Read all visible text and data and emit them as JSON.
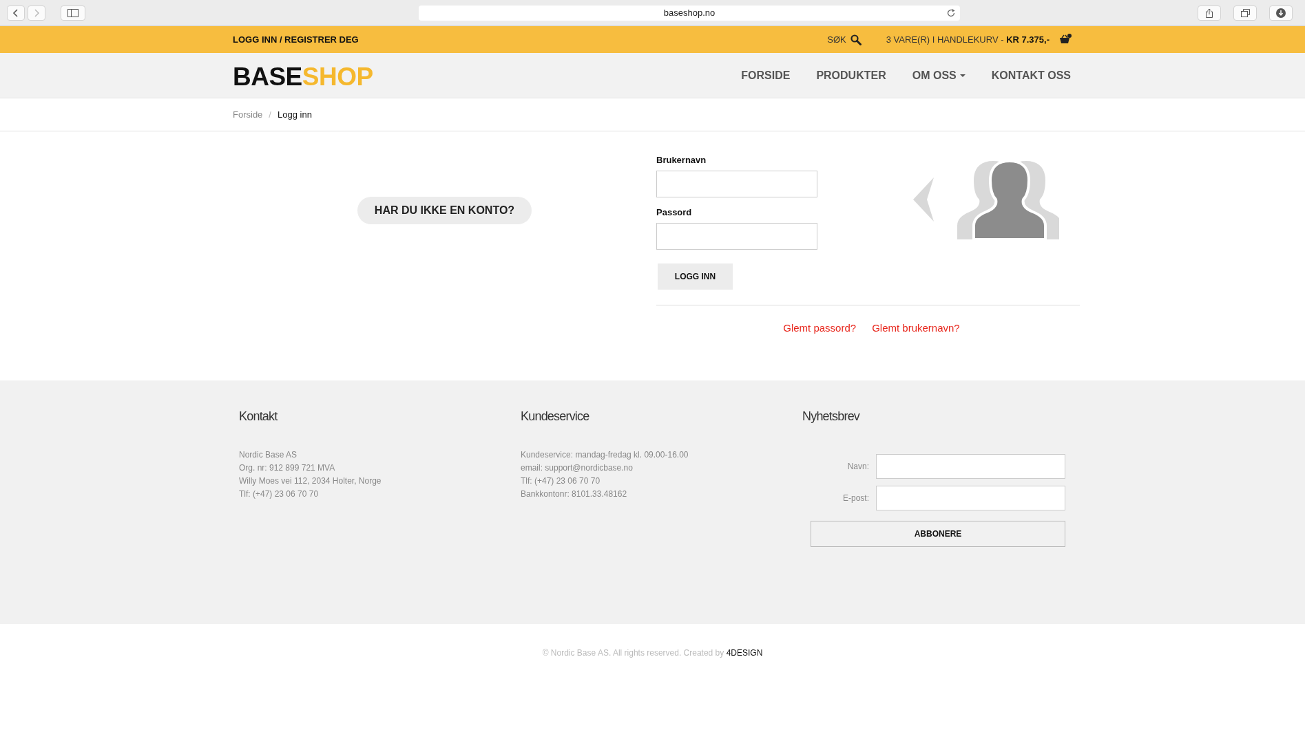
{
  "browser": {
    "url": "baseshop.no"
  },
  "top_bar": {
    "login_link": "LOGG INN / REGISTRER DEG",
    "search_label": "SØK",
    "cart": "3 VARE(R) I HANDLEKURV - **KR 7.375,-**"
  },
  "logo": {
    "first": "BASE",
    "second": "SHOP"
  },
  "nav": [
    {
      "label": "FORSIDE",
      "dropdown": false
    },
    {
      "label": "PRODUKTER",
      "dropdown": false
    },
    {
      "label": "OM OSS",
      "dropdown": true
    },
    {
      "label": "KONTAKT OSS",
      "dropdown": false
    }
  ],
  "breadcrumb": {
    "separator": "/",
    "items": [
      {
        "label": "Forside",
        "current": false
      },
      {
        "label": "Logg inn",
        "current": true
      }
    ]
  },
  "register_button": "HAR DU IKKE EN KONTO?",
  "login": {
    "fields": [
      {
        "label": "Brukernavn"
      },
      {
        "label": "Passord"
      }
    ],
    "button": "LOGG INN",
    "links": [
      "Glemt passord?",
      "Glemt brukernavn?"
    ]
  },
  "footer": {
    "columns": [
      {
        "title": "Kontakt",
        "lines": [
          "Nordic Base AS",
          "Org. nr: 912 899 721 MVA",
          "Willy Moes vei 112, 2034 Holter, Norge",
          "Tlf: (+47) 23 06 70 70"
        ]
      },
      {
        "title": "Kundeservice",
        "lines": [
          "Kundeservice: mandag-fredag kl. 09.00-16.00",
          "email: support@nordicbase.no",
          "Tlf: (+47) 23 06 70 70",
          "Bankkontonr: 8101.33.48162"
        ]
      }
    ],
    "newsletter": {
      "title": "Nyhetsbrev",
      "fields": [
        {
          "label": "Navn:"
        },
        {
          "label": "E-post:"
        }
      ],
      "button": "ABBONERE"
    }
  },
  "copyright": {
    "text": "© Nordic Base AS. All rights reserved. Created by",
    "link": "4DESIGN"
  }
}
